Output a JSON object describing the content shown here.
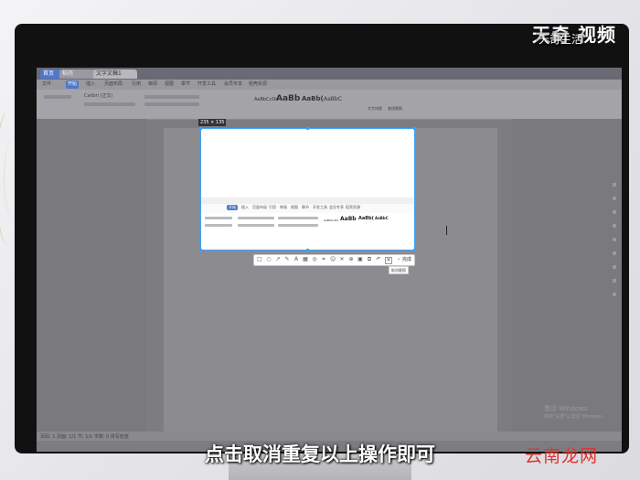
{
  "window": {
    "tabs": [
      "首页",
      "稻壳",
      "文字文稿1"
    ]
  },
  "menu": [
    "文件",
    "开始",
    "插入",
    "页面布局",
    "引用",
    "审阅",
    "视图",
    "章节",
    "开发工具",
    "会员专享",
    "稻壳资源"
  ],
  "ribbon": {
    "font_name": "Calibri (正文)",
    "styles": [
      "AaBbCcDd",
      "AaBb",
      "AaBb(",
      "AaBbC"
    ],
    "right_buttons": [
      "文字排版",
      "查找替换"
    ]
  },
  "screenshot": {
    "size_label": "235 × 135",
    "inner_menu": [
      "开始",
      "插入",
      "页面布局",
      "引用",
      "审阅",
      "视图",
      "章节",
      "开发工具",
      "会员专享",
      "稻壳资源"
    ],
    "inner_styles": [
      "AaBbCcDd",
      "AaBb",
      "AaBb(",
      "AaBbC"
    ]
  },
  "toolbar": {
    "icons": [
      "rect-icon",
      "ellipse-icon",
      "arrow-icon",
      "pen-icon",
      "text-icon",
      "mosaic-icon",
      "blur-icon",
      "ocr-icon",
      "sticker-icon",
      "cross-icon",
      "pin-icon",
      "save-icon",
      "copy-icon",
      "undo-icon",
      "cancel-icon"
    ],
    "done_label": "完成",
    "tooltip": "取消截图"
  },
  "status": {
    "text": "页码: 1  页面: 1/1  节: 1/1  字数: 0  拼写检查"
  },
  "watermarks": {
    "brand": "天奇",
    "brand2": "视频",
    "brand_sub": "天奇生活",
    "site": "云南龙网",
    "activate": "激活 Windows",
    "activate_sub": "转到\"设置\"以激活 Windows。"
  },
  "caption": "点击取消重复以上操作即可"
}
